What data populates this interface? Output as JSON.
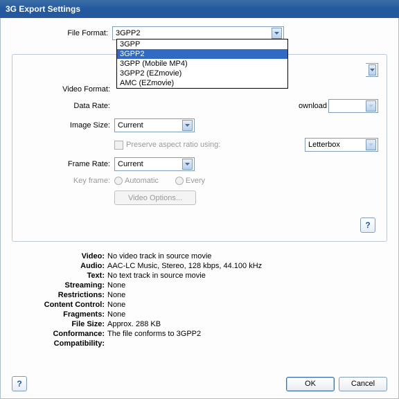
{
  "window": {
    "title": "3G Export Settings"
  },
  "file_format": {
    "label": "File Format:",
    "value": "3GPP2",
    "options": [
      "3GPP",
      "3GPP2",
      "3GPP (Mobile MP4)",
      "3GPP2 (EZmovie)",
      "AMC (EZmovie)"
    ],
    "selected_index": 1
  },
  "tabs_partial": "V",
  "video_format": {
    "label": "Video Format:"
  },
  "data_rate": {
    "label": "Data Rate:",
    "extra": "ownload"
  },
  "image_size": {
    "label": "Image Size:",
    "value": "Current"
  },
  "preserve": {
    "label": "Preserve aspect ratio using:"
  },
  "letterbox": {
    "value": "Letterbox"
  },
  "frame_rate": {
    "label": "Frame Rate:",
    "value": "Current"
  },
  "key_frame": {
    "label": "Key frame:",
    "opt1": "Automatic",
    "opt2": "Every"
  },
  "video_options_btn": "Video Options...",
  "help_glyph": "?",
  "summary": {
    "rows": [
      {
        "k": "Video:",
        "v": "No video track in source movie"
      },
      {
        "k": "Audio:",
        "v": "AAC-LC Music, Stereo, 128 kbps, 44.100 kHz"
      },
      {
        "k": "Text:",
        "v": "No text track in source movie"
      },
      {
        "k": "Streaming:",
        "v": "None"
      },
      {
        "k": "Restrictions:",
        "v": "None"
      },
      {
        "k": "Content Control:",
        "v": "None"
      },
      {
        "k": "Fragments:",
        "v": "None"
      },
      {
        "k": "File Size:",
        "v": "Approx. 288 KB"
      },
      {
        "k": "Conformance:",
        "v": "The file conforms to 3GPP2"
      },
      {
        "k": "Compatibility:",
        "v": ""
      }
    ]
  },
  "buttons": {
    "ok": "OK",
    "cancel": "Cancel"
  }
}
